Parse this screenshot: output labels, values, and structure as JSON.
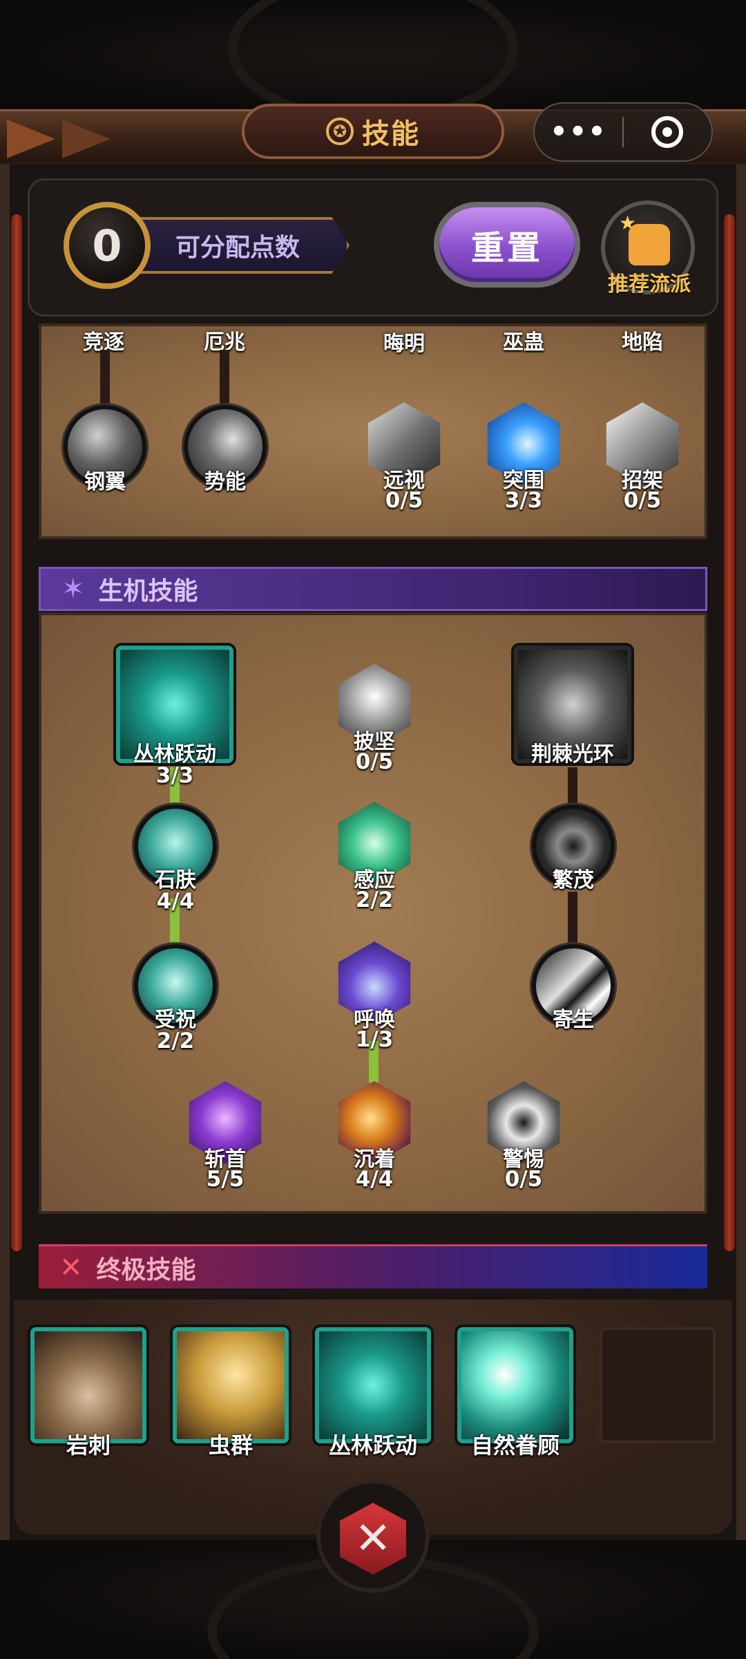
{
  "title": "技能",
  "points": {
    "value": "0",
    "label": "可分配点数"
  },
  "reset_label": "重置",
  "recommend_label": "推荐流派",
  "top_tree": {
    "cut_labels": [
      "竞逐",
      "厄兆",
      "晦明",
      "巫蛊",
      "地陷"
    ],
    "nodes": [
      {
        "name": "钢翼",
        "level": ""
      },
      {
        "name": "势能",
        "level": ""
      },
      {
        "name": "远视",
        "level": "0/5"
      },
      {
        "name": "突围",
        "level": "3/3"
      },
      {
        "name": "招架",
        "level": "0/5"
      }
    ]
  },
  "life_section": {
    "title": "生机技能",
    "nodes": {
      "jungle_leap": {
        "name": "丛林跃动",
        "level": "3/3"
      },
      "pijian": {
        "name": "披坚",
        "level": "0/5"
      },
      "thorn_aura": {
        "name": "荆棘光环",
        "level": ""
      },
      "stone_skin": {
        "name": "石肤",
        "level": "4/4"
      },
      "ganying": {
        "name": "感应",
        "level": "2/2"
      },
      "fanmao": {
        "name": "繁茂",
        "level": ""
      },
      "shouzhu": {
        "name": "受祝",
        "level": "2/2"
      },
      "huhuan": {
        "name": "呼唤",
        "level": "1/3"
      },
      "jisheng": {
        "name": "寄生",
        "level": ""
      },
      "zhanshou": {
        "name": "斩首",
        "level": "5/5"
      },
      "chenzhuo": {
        "name": "沉着",
        "level": "4/4"
      },
      "jingti": {
        "name": "警惕",
        "level": "0/5"
      }
    }
  },
  "ultimate_section": {
    "title": "终极技能",
    "cards": [
      "岩刺",
      "虫群",
      "丛林跃动",
      "自然眷顾"
    ]
  },
  "capsule": {
    "more": "•••"
  }
}
